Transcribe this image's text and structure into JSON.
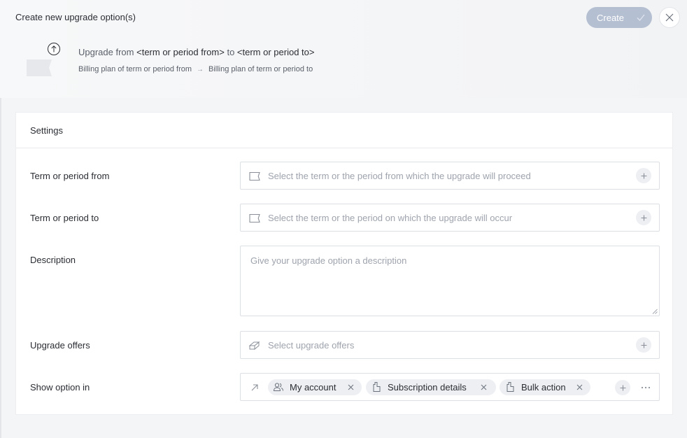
{
  "dialog": {
    "title": "Create new upgrade option(s)",
    "create_label": "Create",
    "close_icon": "close-icon"
  },
  "summary": {
    "prefix": "Upgrade from",
    "from_token": "<term or period from>",
    "connector": "to",
    "to_token": "<term or period to>",
    "sub_from": "Billing plan of term or period from",
    "sub_arrow": "→",
    "sub_to": "Billing plan of term or period to"
  },
  "settings": {
    "heading": "Settings",
    "term_from": {
      "label": "Term or period from",
      "placeholder": "Select the term or the period from which the upgrade will proceed",
      "icon": "ticket-icon"
    },
    "term_to": {
      "label": "Term or period to",
      "placeholder": "Select the term or the period on which the upgrade will occur",
      "icon": "ticket-icon"
    },
    "description": {
      "label": "Description",
      "placeholder": "Give your upgrade option a description"
    },
    "offers": {
      "label": "Upgrade offers",
      "placeholder": "Select upgrade offers",
      "icon": "offers-icon"
    },
    "show_in": {
      "label": "Show option in",
      "icon": "arrow-up-right-icon",
      "chips": [
        {
          "label": "My account",
          "icon": "users-icon"
        },
        {
          "label": "Subscription details",
          "icon": "clipboard-icon"
        },
        {
          "label": "Bulk action",
          "icon": "clipboard-icon"
        }
      ]
    }
  },
  "colors": {
    "accent_disabled": "#b5bfd2",
    "field_border": "#dcdfe4",
    "placeholder": "#9ea3ad"
  }
}
